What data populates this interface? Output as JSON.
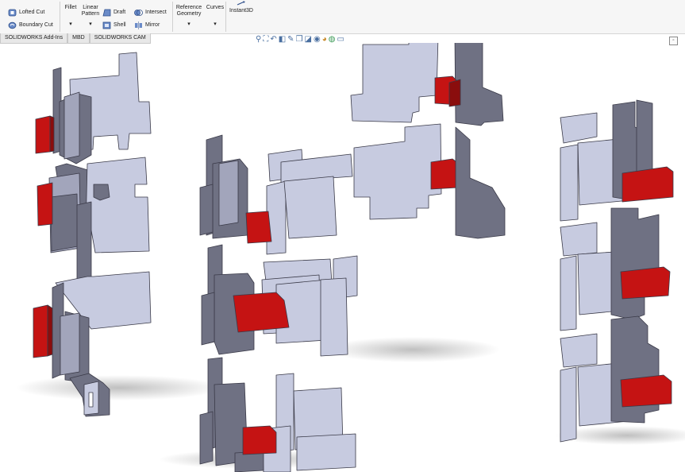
{
  "ribbon": {
    "lofted_cut": "Lofted Cut",
    "boundary_cut": "Boundary Cut",
    "fillet": "Fillet",
    "linear_pattern_1": "Linear",
    "linear_pattern_2": "Pattern",
    "draft": "Draft",
    "intersect": "Intersect",
    "shell": "Shell",
    "mirror": "Mirror",
    "reference_geometry_1": "Reference",
    "reference_geometry_2": "Geometry",
    "curves": "Curves",
    "instant3d": "Instant3D",
    "dropdown_glyph": "▾"
  },
  "tabs": [
    "SOLIDWORKS Add-Ins",
    "MBD",
    "SOLIDWORKS CAM"
  ],
  "hud_icons": [
    "search-icon",
    "zoom-area-icon",
    "previous-view-icon",
    "section-view-icon",
    "dynamic-annotation-icon",
    "view-orientation-icon",
    "display-style-icon",
    "hide-show-icon",
    "appearance-icon",
    "scene-icon",
    "display-settings-icon"
  ],
  "colors": {
    "plate_face": "#c7cbe0",
    "plate_side": "#6f7183",
    "clip_red": "#c51313",
    "ribbon_bg": "#f6f6f6"
  }
}
